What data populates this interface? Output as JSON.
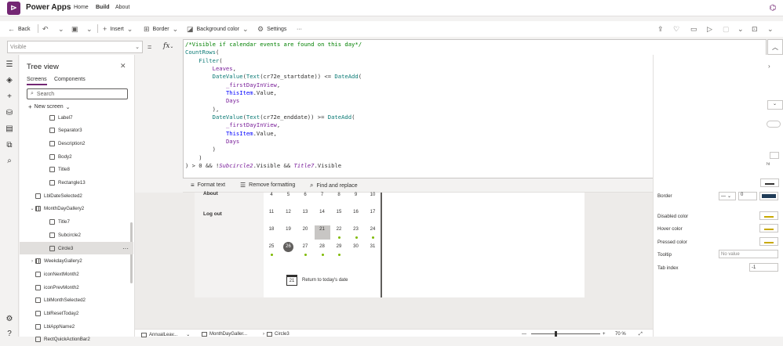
{
  "app": {
    "name": "Power Apps",
    "logo_glyph": "⊳"
  },
  "topnav": {
    "home": "Home",
    "build": "Build",
    "about": "About"
  },
  "commands": {
    "back": "Back",
    "insert": "Insert",
    "border": "Border",
    "background_color": "Background color",
    "settings": "Settings",
    "more": "···"
  },
  "formula": {
    "property": "Visible",
    "eq": "=",
    "fx": "fx",
    "lines": [
      "/*Visible if calendar events are found on this day*/",
      "CountRows(",
      "    Filter(",
      "        Leaves,",
      "        DateValue(Text(cr72e_startdate)) <= DateAdd(",
      "            _firstDayInView,",
      "            ThisItem.Value,",
      "            Days",
      "        ),",
      "        DateValue(Text(cr72e_enddate)) >= DateAdd(",
      "            _firstDayInView,",
      "            ThisItem.Value,",
      "            Days",
      "        )",
      "    )",
      ") > 0 && !Subcircle2.Visible && Title7.Visible"
    ],
    "tools": {
      "format": "Format text",
      "remove": "Remove formatting",
      "find": "Find and replace"
    }
  },
  "tree": {
    "title": "Tree view",
    "tabs": {
      "screens": "Screens",
      "components": "Components"
    },
    "search_placeholder": "Search",
    "new_screen": "New screen",
    "nodes": [
      {
        "label": "Label7",
        "indent": 2,
        "kind": "ctl"
      },
      {
        "label": "Separator3",
        "indent": 2,
        "kind": "ctl"
      },
      {
        "label": "Description2",
        "indent": 2,
        "kind": "ctl"
      },
      {
        "label": "Body2",
        "indent": 2,
        "kind": "ctl"
      },
      {
        "label": "Title8",
        "indent": 2,
        "kind": "ctl"
      },
      {
        "label": "Rectangle13",
        "indent": 2,
        "kind": "ctl"
      },
      {
        "label": "LblDateSelected2",
        "indent": 1,
        "kind": "ctl"
      },
      {
        "label": "MonthDayGallery2",
        "indent": 1,
        "kind": "grid",
        "expanded": true
      },
      {
        "label": "Title7",
        "indent": 2,
        "kind": "ctl"
      },
      {
        "label": "Subcircle2",
        "indent": 2,
        "kind": "ctl"
      },
      {
        "label": "Circle3",
        "indent": 2,
        "kind": "ctl",
        "selected": true
      },
      {
        "label": "WeekdayGallery2",
        "indent": 1,
        "kind": "grid",
        "collapsed": true
      },
      {
        "label": "iconNextMonth2",
        "indent": 1,
        "kind": "ctl"
      },
      {
        "label": "iconPrevMonth2",
        "indent": 1,
        "kind": "ctl"
      },
      {
        "label": "LblMonthSelected2",
        "indent": 1,
        "kind": "ctl"
      },
      {
        "label": "LblResetToday2",
        "indent": 1,
        "kind": "ctl"
      },
      {
        "label": "LblAppName2",
        "indent": 1,
        "kind": "ctl"
      },
      {
        "label": "RectQuickActionBar2",
        "indent": 1,
        "kind": "ctl"
      }
    ],
    "more_glyph": "···"
  },
  "canvas": {
    "nav": {
      "about": "About",
      "logout": "Log out"
    },
    "weeks": [
      [
        {
          "d": "4"
        },
        {
          "d": "5"
        },
        {
          "d": "6"
        },
        {
          "d": "7"
        },
        {
          "d": "8"
        },
        {
          "d": "9"
        },
        {
          "d": "10"
        }
      ],
      [
        {
          "d": "11"
        },
        {
          "d": "12"
        },
        {
          "d": "13"
        },
        {
          "d": "14"
        },
        {
          "d": "15"
        },
        {
          "d": "16"
        },
        {
          "d": "17"
        }
      ],
      [
        {
          "d": "18"
        },
        {
          "d": "19"
        },
        {
          "d": "20"
        },
        {
          "d": "21",
          "selected": true
        },
        {
          "d": "22",
          "dot": true
        },
        {
          "d": "23",
          "dot": true
        },
        {
          "d": "24",
          "dot": true
        }
      ],
      [
        {
          "d": "25",
          "dot": true
        },
        {
          "d": "26",
          "today": true
        },
        {
          "d": "27",
          "dot": true
        },
        {
          "d": "28",
          "dot": true
        },
        {
          "d": "29",
          "dot": true
        },
        {
          "d": "30"
        },
        {
          "d": "31"
        }
      ]
    ],
    "today_icon_num": "21",
    "today_label": "Return to today's date"
  },
  "properties": {
    "border": "Border",
    "border_width": "0",
    "disabled_color": "Disabled color",
    "hover_color": "Hover color",
    "pressed_color": "Pressed color",
    "tooltip": "Tooltip",
    "tooltip_placeholder": "No value",
    "tab_index": "Tab index",
    "tab_index_value": "-1",
    "partial_label": "ht"
  },
  "statusbar": {
    "screen": "AnnualLeav...",
    "gallery": "MonthDayGaller...",
    "control": "Circle3",
    "zoom": "70 %"
  },
  "colors": {
    "brand": "#742774",
    "event_dot": "#7fba00",
    "accent": "#0078d4"
  }
}
